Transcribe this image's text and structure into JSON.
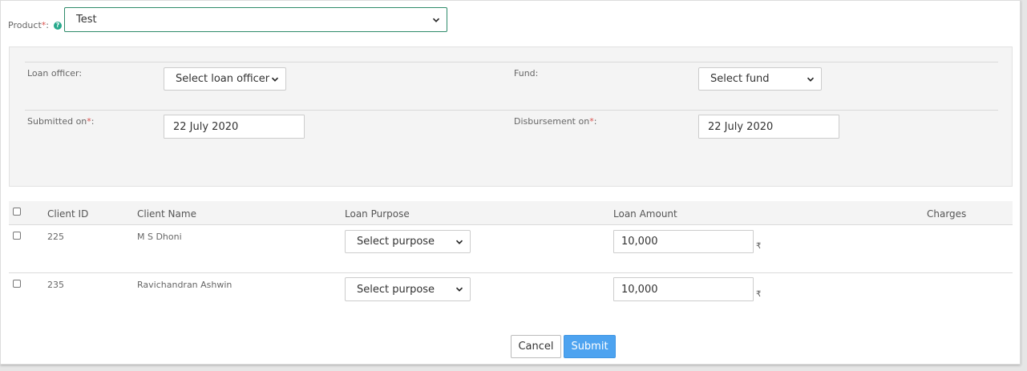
{
  "product": {
    "label": "Product",
    "required_mark": "*",
    "colon": ":",
    "help_glyph": "?",
    "selected": "Test"
  },
  "fields": {
    "loan_officer": {
      "label": "Loan officer:",
      "selected": "Select loan officer"
    },
    "fund": {
      "label": "Fund:",
      "selected": "Select fund"
    },
    "submitted_on": {
      "label": "Submitted on",
      "required_mark": "*",
      "colon": ":",
      "value": "22 July 2020"
    },
    "disbursement_on": {
      "label": "Disbursement on",
      "required_mark": "*",
      "colon": ":",
      "value": "22 July 2020"
    }
  },
  "table": {
    "headers": {
      "client_id": "Client ID",
      "client_name": "Client Name",
      "loan_purpose": "Loan Purpose",
      "loan_amount": "Loan Amount",
      "charges": "Charges"
    },
    "rows": [
      {
        "client_id": "225",
        "client_name": "M S Dhoni",
        "purpose": "Select purpose",
        "amount": "10,000",
        "currency": "₹"
      },
      {
        "client_id": "235",
        "client_name": "Ravichandran Ashwin",
        "purpose": "Select purpose",
        "amount": "10,000",
        "currency": "₹"
      }
    ]
  },
  "actions": {
    "cancel": "Cancel",
    "submit": "Submit"
  },
  "colors": {
    "accent_green": "#27a98c",
    "submit_blue": "#4da3f0",
    "required_red": "#d9534f"
  }
}
